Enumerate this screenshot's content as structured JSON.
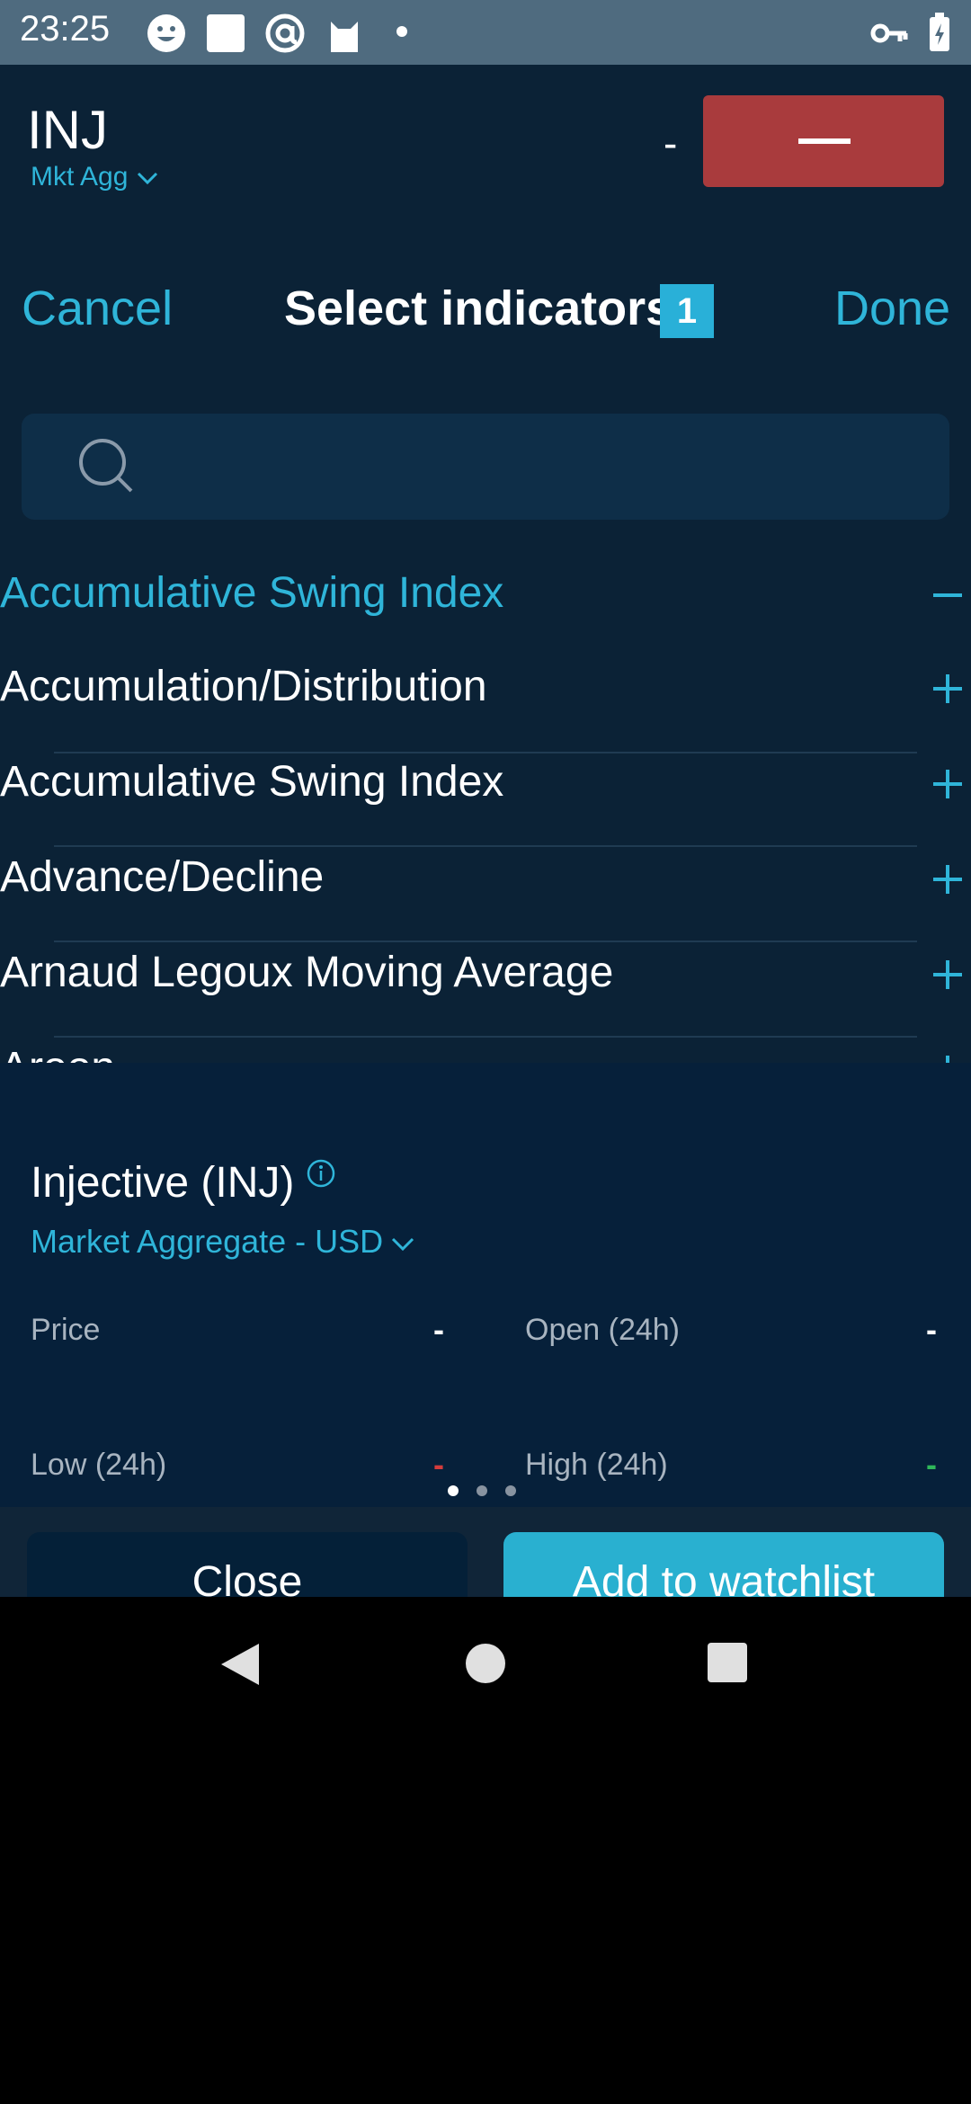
{
  "status_bar": {
    "time": "23:25",
    "icons": [
      "smiley-icon",
      "square-icon",
      "at-icon",
      "cat-icon",
      "dot-icon",
      "key-icon",
      "battery-icon"
    ]
  },
  "header": {
    "symbol": "INJ",
    "market": "Mkt Agg",
    "price_placeholder": "-"
  },
  "selector": {
    "cancel_label": "Cancel",
    "title": "Select indicators",
    "selected_count": "1",
    "done_label": "Done",
    "search_placeholder": ""
  },
  "indicators": [
    {
      "label": "Accumulative Swing Index",
      "selected": true
    },
    {
      "label": "Accumulation/Distribution",
      "selected": false
    },
    {
      "label": "Accumulative Swing Index",
      "selected": false
    },
    {
      "label": "Advance/Decline",
      "selected": false
    },
    {
      "label": "Arnaud Legoux Moving Average",
      "selected": false
    },
    {
      "label": "Aroon",
      "selected": false
    }
  ],
  "sheet": {
    "asset_title": "Injective (INJ)",
    "exchange": "Market Aggregate - USD",
    "stats": {
      "price_label": "Price",
      "price_value": "-",
      "open_label": "Open (24h)",
      "open_value": "-",
      "low_label": "Low (24h)",
      "low_value": "-",
      "high_label": "High (24h)",
      "high_value": "-"
    },
    "page_count": 3,
    "active_page": 1,
    "close_label": "Close",
    "add_label": "Add to watchlist"
  },
  "colors": {
    "accent": "#2fb5d9",
    "danger": "#a93b3d",
    "low": "#d43c3c",
    "high": "#2fb85a"
  }
}
